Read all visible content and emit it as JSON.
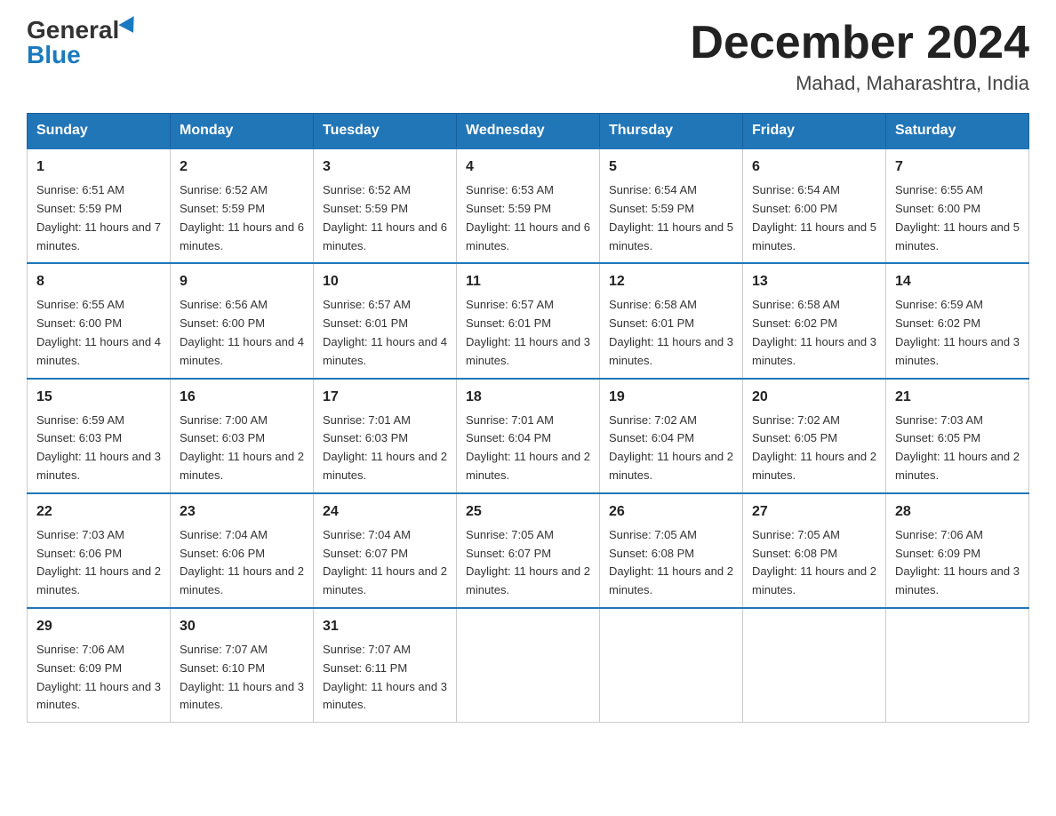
{
  "header": {
    "logo_general": "General",
    "logo_blue": "Blue",
    "month_title": "December 2024",
    "location": "Mahad, Maharashtra, India"
  },
  "days_of_week": [
    "Sunday",
    "Monday",
    "Tuesday",
    "Wednesday",
    "Thursday",
    "Friday",
    "Saturday"
  ],
  "weeks": [
    [
      {
        "day": "1",
        "sunrise": "6:51 AM",
        "sunset": "5:59 PM",
        "daylight": "11 hours and 7 minutes."
      },
      {
        "day": "2",
        "sunrise": "6:52 AM",
        "sunset": "5:59 PM",
        "daylight": "11 hours and 6 minutes."
      },
      {
        "day": "3",
        "sunrise": "6:52 AM",
        "sunset": "5:59 PM",
        "daylight": "11 hours and 6 minutes."
      },
      {
        "day": "4",
        "sunrise": "6:53 AM",
        "sunset": "5:59 PM",
        "daylight": "11 hours and 6 minutes."
      },
      {
        "day": "5",
        "sunrise": "6:54 AM",
        "sunset": "5:59 PM",
        "daylight": "11 hours and 5 minutes."
      },
      {
        "day": "6",
        "sunrise": "6:54 AM",
        "sunset": "6:00 PM",
        "daylight": "11 hours and 5 minutes."
      },
      {
        "day": "7",
        "sunrise": "6:55 AM",
        "sunset": "6:00 PM",
        "daylight": "11 hours and 5 minutes."
      }
    ],
    [
      {
        "day": "8",
        "sunrise": "6:55 AM",
        "sunset": "6:00 PM",
        "daylight": "11 hours and 4 minutes."
      },
      {
        "day": "9",
        "sunrise": "6:56 AM",
        "sunset": "6:00 PM",
        "daylight": "11 hours and 4 minutes."
      },
      {
        "day": "10",
        "sunrise": "6:57 AM",
        "sunset": "6:01 PM",
        "daylight": "11 hours and 4 minutes."
      },
      {
        "day": "11",
        "sunrise": "6:57 AM",
        "sunset": "6:01 PM",
        "daylight": "11 hours and 3 minutes."
      },
      {
        "day": "12",
        "sunrise": "6:58 AM",
        "sunset": "6:01 PM",
        "daylight": "11 hours and 3 minutes."
      },
      {
        "day": "13",
        "sunrise": "6:58 AM",
        "sunset": "6:02 PM",
        "daylight": "11 hours and 3 minutes."
      },
      {
        "day": "14",
        "sunrise": "6:59 AM",
        "sunset": "6:02 PM",
        "daylight": "11 hours and 3 minutes."
      }
    ],
    [
      {
        "day": "15",
        "sunrise": "6:59 AM",
        "sunset": "6:03 PM",
        "daylight": "11 hours and 3 minutes."
      },
      {
        "day": "16",
        "sunrise": "7:00 AM",
        "sunset": "6:03 PM",
        "daylight": "11 hours and 2 minutes."
      },
      {
        "day": "17",
        "sunrise": "7:01 AM",
        "sunset": "6:03 PM",
        "daylight": "11 hours and 2 minutes."
      },
      {
        "day": "18",
        "sunrise": "7:01 AM",
        "sunset": "6:04 PM",
        "daylight": "11 hours and 2 minutes."
      },
      {
        "day": "19",
        "sunrise": "7:02 AM",
        "sunset": "6:04 PM",
        "daylight": "11 hours and 2 minutes."
      },
      {
        "day": "20",
        "sunrise": "7:02 AM",
        "sunset": "6:05 PM",
        "daylight": "11 hours and 2 minutes."
      },
      {
        "day": "21",
        "sunrise": "7:03 AM",
        "sunset": "6:05 PM",
        "daylight": "11 hours and 2 minutes."
      }
    ],
    [
      {
        "day": "22",
        "sunrise": "7:03 AM",
        "sunset": "6:06 PM",
        "daylight": "11 hours and 2 minutes."
      },
      {
        "day": "23",
        "sunrise": "7:04 AM",
        "sunset": "6:06 PM",
        "daylight": "11 hours and 2 minutes."
      },
      {
        "day": "24",
        "sunrise": "7:04 AM",
        "sunset": "6:07 PM",
        "daylight": "11 hours and 2 minutes."
      },
      {
        "day": "25",
        "sunrise": "7:05 AM",
        "sunset": "6:07 PM",
        "daylight": "11 hours and 2 minutes."
      },
      {
        "day": "26",
        "sunrise": "7:05 AM",
        "sunset": "6:08 PM",
        "daylight": "11 hours and 2 minutes."
      },
      {
        "day": "27",
        "sunrise": "7:05 AM",
        "sunset": "6:08 PM",
        "daylight": "11 hours and 2 minutes."
      },
      {
        "day": "28",
        "sunrise": "7:06 AM",
        "sunset": "6:09 PM",
        "daylight": "11 hours and 3 minutes."
      }
    ],
    [
      {
        "day": "29",
        "sunrise": "7:06 AM",
        "sunset": "6:09 PM",
        "daylight": "11 hours and 3 minutes."
      },
      {
        "day": "30",
        "sunrise": "7:07 AM",
        "sunset": "6:10 PM",
        "daylight": "11 hours and 3 minutes."
      },
      {
        "day": "31",
        "sunrise": "7:07 AM",
        "sunset": "6:11 PM",
        "daylight": "11 hours and 3 minutes."
      },
      null,
      null,
      null,
      null
    ]
  ]
}
